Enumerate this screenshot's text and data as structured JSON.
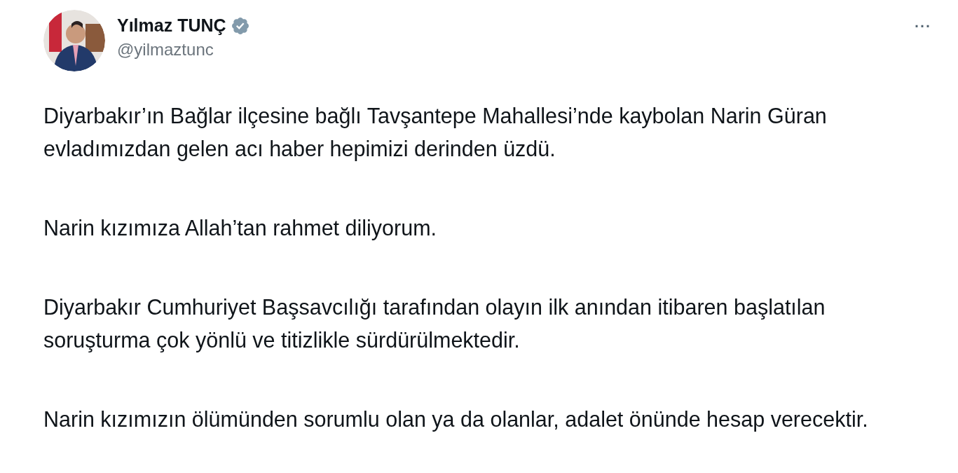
{
  "author": {
    "name": "Yılmaz TUNÇ",
    "handle": "@yilmaztunc",
    "verified": true
  },
  "menu": {
    "label": "···"
  },
  "paragraphs": [
    "Diyarbakır’ın Bağlar ilçesine bağlı Tavşantepe Mahallesi’nde kaybolan Narin Güran evladımızdan gelen acı haber hepimizi derinden üzdü.",
    "Narin kızımıza Allah’tan rahmet diliyorum.",
    "Diyarbakır Cumhuriyet Başsavcılığı tarafından olayın ilk anından itibaren başlatılan soruşturma çok yönlü ve titizlikle sürdürülmektedir.",
    "Narin kızımızın ölümünden sorumlu olan ya da olanlar, adalet önünde hesap verecektir."
  ]
}
